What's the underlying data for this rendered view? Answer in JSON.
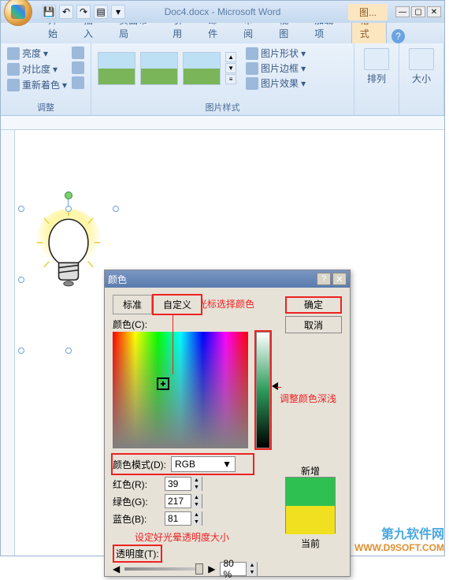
{
  "app": {
    "doc_title": "Doc4.docx - Microsoft Word",
    "context_label": "图...",
    "help": "?"
  },
  "qat": {
    "save": "💾",
    "undo": "↶",
    "redo": "↷",
    "print": "▤",
    "more": "▾"
  },
  "win": {
    "min": "—",
    "max": "▢",
    "close": "✕"
  },
  "tabs": {
    "start": "开始",
    "insert": "插入",
    "layout": "页面布局",
    "ref": "引用",
    "mail": "邮件",
    "review": "审阅",
    "view": "视图",
    "addin": "加载项",
    "format": "格式"
  },
  "ribbon": {
    "adjust": {
      "brightness": "亮度",
      "contrast": "对比度",
      "recolor": "重新着色",
      "label": "调整",
      "arrow": "▾"
    },
    "styles": {
      "label": "图片样式",
      "shape": "图片形状",
      "border": "图片边框",
      "effect": "图片效果",
      "up": "▲",
      "down": "▼",
      "more": "≡"
    },
    "arrange": {
      "label": "排列"
    },
    "size": {
      "label": "大小"
    }
  },
  "dialog": {
    "title": "颜色",
    "tab_std": "标准",
    "tab_custom": "自定义",
    "ok": "确定",
    "cancel": "取消",
    "color_label": "颜色(C):",
    "mode_label": "颜色模式(D):",
    "mode_value": "RGB",
    "mode_arrow": "▼",
    "red_label": "红色(R):",
    "green_label": "绿色(G):",
    "blue_label": "蓝色(B):",
    "red_val": "39",
    "green_val": "217",
    "blue_val": "81",
    "transparency_label": "透明度(T):",
    "transp_left": "◀",
    "transp_right": "▶",
    "transp_val": "80 %",
    "spin_up": "▲",
    "spin_down": "▼",
    "new_label": "新增",
    "current_label": "当前",
    "help_btn": "?",
    "close_btn": "✕"
  },
  "annotations": {
    "cursor_sel": "光标选择颜色",
    "adjust_depth": "调整颜色深浅",
    "set_transp": "设定好光晕透明度大小"
  },
  "watermark": {
    "line1": "第九软件网",
    "line2": "WWW.D9SOFT.COM"
  }
}
